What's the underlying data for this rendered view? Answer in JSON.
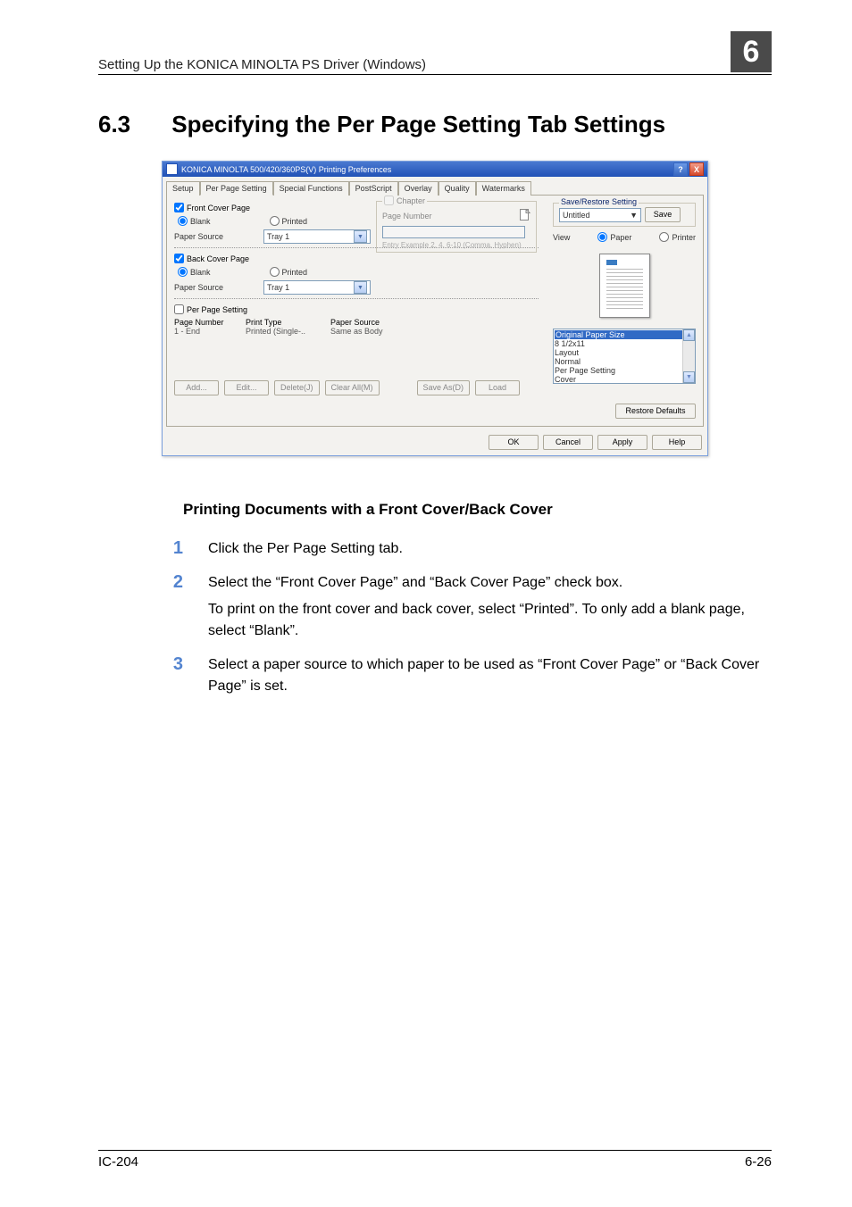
{
  "header": {
    "breadcrumb": "Setting Up the KONICA MINOLTA PS Driver (Windows)",
    "chapter": "6"
  },
  "section": {
    "number": "6.3",
    "title": "Specifying the Per Page Setting Tab Settings"
  },
  "dlg": {
    "title": "KONICA MINOLTA 500/420/360PS(V) Printing Preferences",
    "help": "?",
    "close": "X",
    "tabs": [
      "Setup",
      "Per Page Setting",
      "Special Functions",
      "PostScript",
      "Overlay",
      "Quality",
      "Watermarks"
    ],
    "active_tab": "Per Page Setting",
    "front": {
      "chk": "Front Cover Page",
      "blank": "Blank",
      "printed": "Printed",
      "src_label": "Paper Source",
      "src_value": "Tray 1"
    },
    "back": {
      "chk": "Back Cover Page",
      "blank": "Blank",
      "printed": "Printed",
      "src_label": "Paper Source",
      "src_value": "Tray 1"
    },
    "pps_chk": "Per Page Setting",
    "list": {
      "h1": "Page Number",
      "h2": "Print Type",
      "h3": "Paper Source",
      "r1": "1 - End",
      "r2": "Printed (Single-..",
      "r3": "Same as Body"
    },
    "chapter": {
      "chk": "Chapter",
      "pg_label": "Page Number",
      "example": "Entry Example 2, 4, 6-10 (Comma, Hyphen)"
    },
    "btns": {
      "add": "Add...",
      "edit": "Edit...",
      "del": "Delete(J)",
      "clear": "Clear All(M)",
      "saveas": "Save As(D)",
      "load": "Load"
    },
    "sr": {
      "legend": "Save/Restore Setting",
      "value": "Untitled",
      "save": "Save"
    },
    "view": {
      "label": "View",
      "paper": "Paper",
      "printer": "Printer"
    },
    "info": {
      "ops": "Original Paper Size",
      "size": " 8 1/2x11",
      "layout": "Layout",
      "normal": " Normal",
      "pps": "Per Page Setting",
      "cover": " Cover"
    },
    "restore": "Restore Defaults",
    "bottom": {
      "ok": "OK",
      "cancel": "Cancel",
      "apply": "Apply",
      "help": "Help"
    }
  },
  "sub": "Printing Documents with a Front Cover/Back Cover",
  "steps": [
    {
      "n": "1",
      "t": "Click the Per Page Setting tab."
    },
    {
      "n": "2",
      "t": "Select the “Front Cover Page” and “Back Cover Page” check box.",
      "s": "To print on the front cover and back cover, select “Printed”. To only add a blank page, select “Blank”."
    },
    {
      "n": "3",
      "t": "Select a paper source to which paper to be used as “Front Cover Page” or “Back Cover Page” is set."
    }
  ],
  "footer": {
    "left": "IC-204",
    "right": "6-26"
  }
}
